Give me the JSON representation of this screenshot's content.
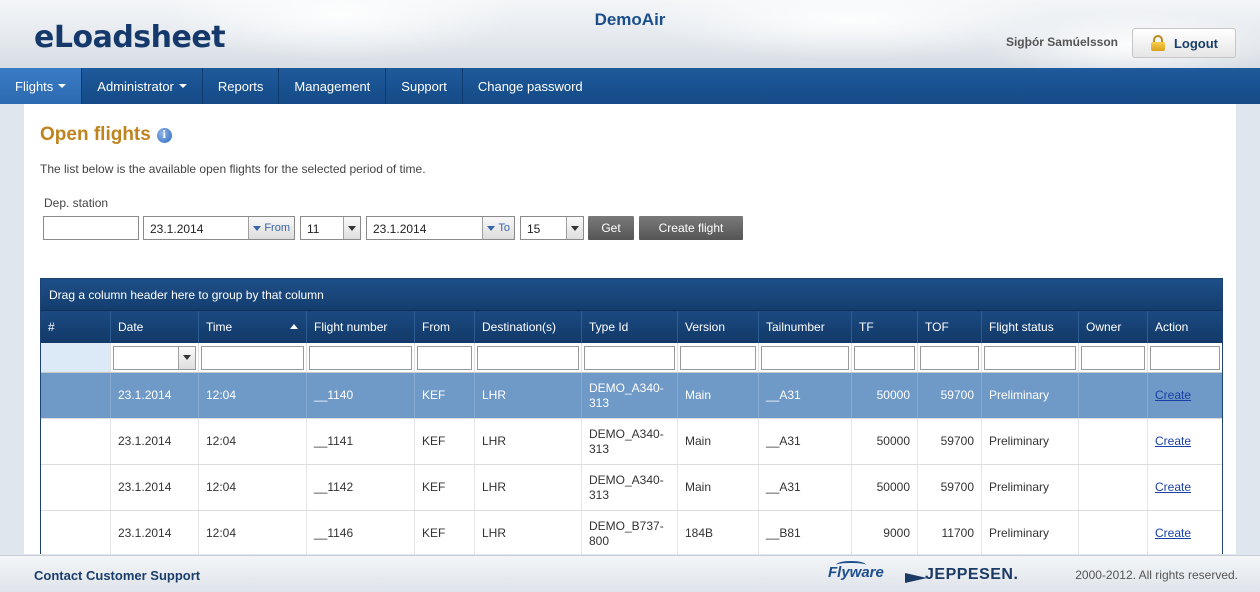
{
  "header": {
    "logo": "eLoadsheet",
    "company": "DemoAir",
    "user": "Sigþór Samúelsson",
    "logout_label": "Logout"
  },
  "nav": [
    {
      "label": "Flights",
      "dropdown": true,
      "active": true
    },
    {
      "label": "Administrator",
      "dropdown": true
    },
    {
      "label": "Reports"
    },
    {
      "label": "Management"
    },
    {
      "label": "Support"
    },
    {
      "label": "Change password"
    }
  ],
  "page": {
    "title": "Open flights",
    "info_icon_glyph": "i",
    "description": "The list below is the available open flights for the selected period of time."
  },
  "filters": {
    "dep_station_label": "Dep. station",
    "dep_station_value": "",
    "from_date": "23.1.2014",
    "from_label": "From",
    "from_hour": "11",
    "to_date": "23.1.2014",
    "to_label": "To",
    "to_hour": "15",
    "get_label": "Get",
    "create_flight_label": "Create flight"
  },
  "grid": {
    "group_hint": "Drag a column header here to group by that column",
    "columns": [
      "#",
      "Date",
      "Time",
      "Flight number",
      "From",
      "Destination(s)",
      "Type Id",
      "Version",
      "Tailnumber",
      "TF",
      "TOF",
      "Flight status",
      "Owner",
      "Action"
    ],
    "sorted_column": "Time",
    "rows": [
      {
        "num": "",
        "date": "23.1.2014",
        "time": "12:04",
        "flight": "__1140",
        "from": "KEF",
        "dest": "LHR",
        "type": "DEMO_A340-313",
        "version": "Main",
        "tail": "__A31",
        "tf": "50000",
        "tof": "59700",
        "status": "Preliminary",
        "owner": "",
        "action": "Create",
        "selected": true
      },
      {
        "num": "",
        "date": "23.1.2014",
        "time": "12:04",
        "flight": "__1141",
        "from": "KEF",
        "dest": "LHR",
        "type": "DEMO_A340-313",
        "version": "Main",
        "tail": "__A31",
        "tf": "50000",
        "tof": "59700",
        "status": "Preliminary",
        "owner": "",
        "action": "Create"
      },
      {
        "num": "",
        "date": "23.1.2014",
        "time": "12:04",
        "flight": "__1142",
        "from": "KEF",
        "dest": "LHR",
        "type": "DEMO_A340-313",
        "version": "Main",
        "tail": "__A31",
        "tf": "50000",
        "tof": "59700",
        "status": "Preliminary",
        "owner": "",
        "action": "Create"
      },
      {
        "num": "",
        "date": "23.1.2014",
        "time": "12:04",
        "flight": "__1146",
        "from": "KEF",
        "dest": "LHR",
        "type": "DEMO_B737-800",
        "version": "184B",
        "tail": "__B81",
        "tf": "9000",
        "tof": "11700",
        "status": "Preliminary",
        "owner": "",
        "action": "Create"
      }
    ]
  },
  "footer": {
    "support_link": "Contact Customer Support",
    "brand1": "Flyware",
    "brand2": "JEPPESEN.",
    "copyright": "2000-2012. All rights reserved."
  },
  "colors": {
    "nav_blue": "#144a86",
    "title_orange": "#c0841e",
    "grid_header": "#123968",
    "selected_row": "#6f99c6"
  }
}
